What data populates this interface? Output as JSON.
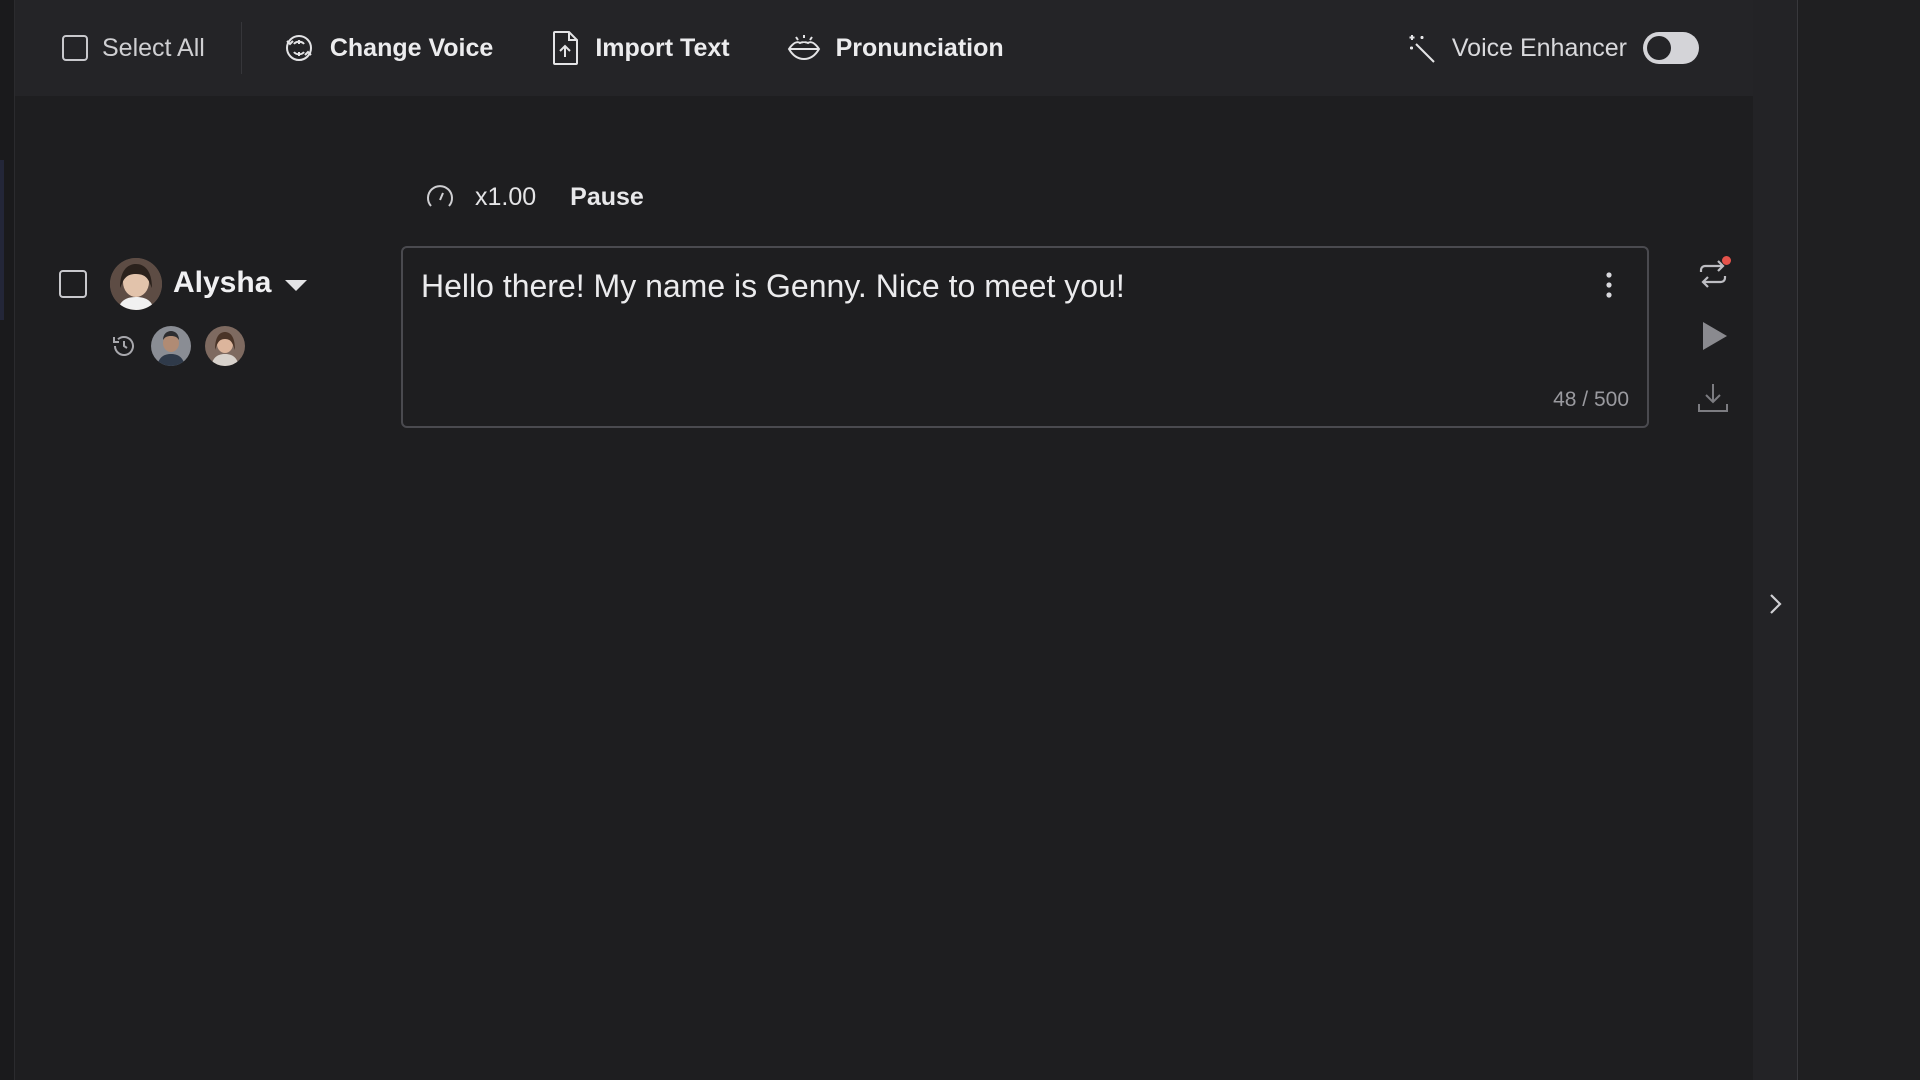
{
  "toolbar": {
    "select_all": "Select All",
    "change_voice": "Change Voice",
    "import_text": "Import Text",
    "pronunciation": "Pronunciation",
    "voice_enhancer": "Voice Enhancer",
    "voice_enhancer_enabled": false
  },
  "speed": {
    "value": "x1.00",
    "pause_label": "Pause"
  },
  "speaker": {
    "name": "Alysha"
  },
  "block": {
    "text": "Hello there! My name is Genny. Nice to meet you!",
    "char_count": "48 / 500"
  },
  "icons": {
    "change_voice": "voice-swap-icon",
    "import_text": "file-upload-icon",
    "pronunciation": "lips-icon",
    "voice_enhancer": "magic-wand-icon",
    "speed": "speedometer-icon",
    "history": "history-icon",
    "regenerate": "regenerate-icon",
    "play": "play-icon",
    "download": "download-icon",
    "more": "kebab-icon",
    "collapse": "chevron-right-icon"
  },
  "colors": {
    "background": "#1e1e20",
    "toolbar": "#242427",
    "notification": "#e5534b"
  }
}
